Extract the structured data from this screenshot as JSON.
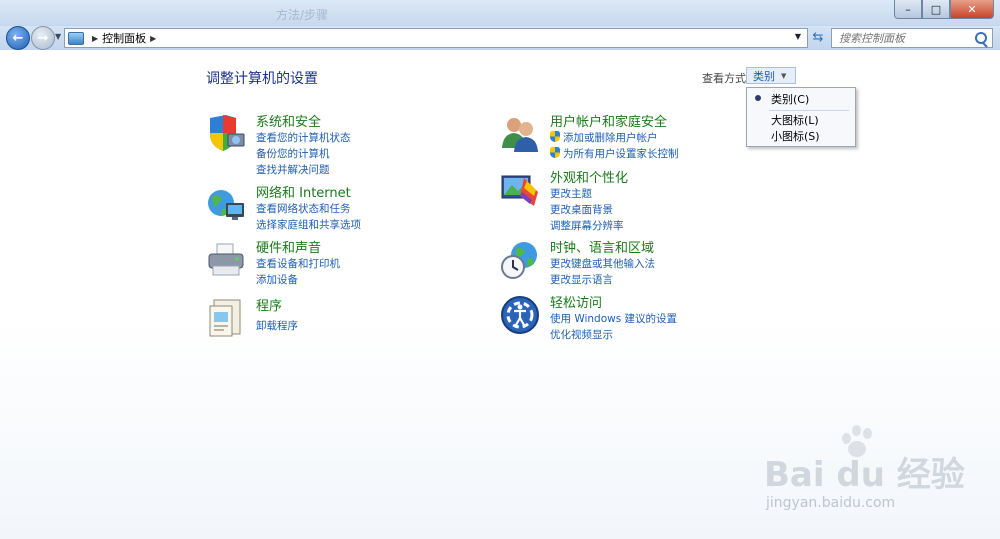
{
  "window": {
    "background_tabs": [
      "方法/步骤"
    ]
  },
  "address": {
    "breadcrumb": [
      "控制面板"
    ]
  },
  "search": {
    "placeholder": "搜索控制面板"
  },
  "page": {
    "title": "调整计算机的设置"
  },
  "view_by": {
    "label": "查看方式:",
    "selected": "类别"
  },
  "view_menu": {
    "items": [
      {
        "label": "类别(C)",
        "selected": true
      },
      {
        "label": "大图标(L)",
        "selected": false
      },
      {
        "label": "小图标(S)",
        "selected": false
      }
    ]
  },
  "categories_left": [
    {
      "title": "系统和安全",
      "icon": "shield-computer-icon",
      "links": [
        "查看您的计算机状态",
        "备份您的计算机",
        "查找并解决问题"
      ]
    },
    {
      "title": "网络和 Internet",
      "icon": "network-globe-icon",
      "links": [
        "查看网络状态和任务",
        "选择家庭组和共享选项"
      ]
    },
    {
      "title": "硬件和声音",
      "icon": "printer-icon",
      "links": [
        "查看设备和打印机",
        "添加设备"
      ]
    },
    {
      "title": "程序",
      "icon": "programs-icon",
      "links": [
        "卸载程序"
      ]
    }
  ],
  "categories_right": [
    {
      "title": "用户帐户和家庭安全",
      "icon": "users-icon",
      "links": [
        "添加或删除用户帐户",
        "为所有用户设置家长控制"
      ]
    },
    {
      "title": "外观和个性化",
      "icon": "appearance-icon",
      "links": [
        "更改主题",
        "更改桌面背景",
        "调整屏幕分辨率"
      ]
    },
    {
      "title": "时钟、语言和区域",
      "icon": "clock-globe-icon",
      "links": [
        "更改键盘或其他输入法",
        "更改显示语言"
      ]
    },
    {
      "title": "轻松访问",
      "icon": "ease-of-access-icon",
      "links": [
        "使用 Windows 建议的设置",
        "优化视频显示"
      ]
    }
  ],
  "watermark": {
    "brand": "Bai du 经验",
    "url": "jingyan.baidu.com"
  },
  "colors": {
    "title": "#1e3287",
    "category": "#1a7a1a",
    "link": "#1e5fb0"
  }
}
